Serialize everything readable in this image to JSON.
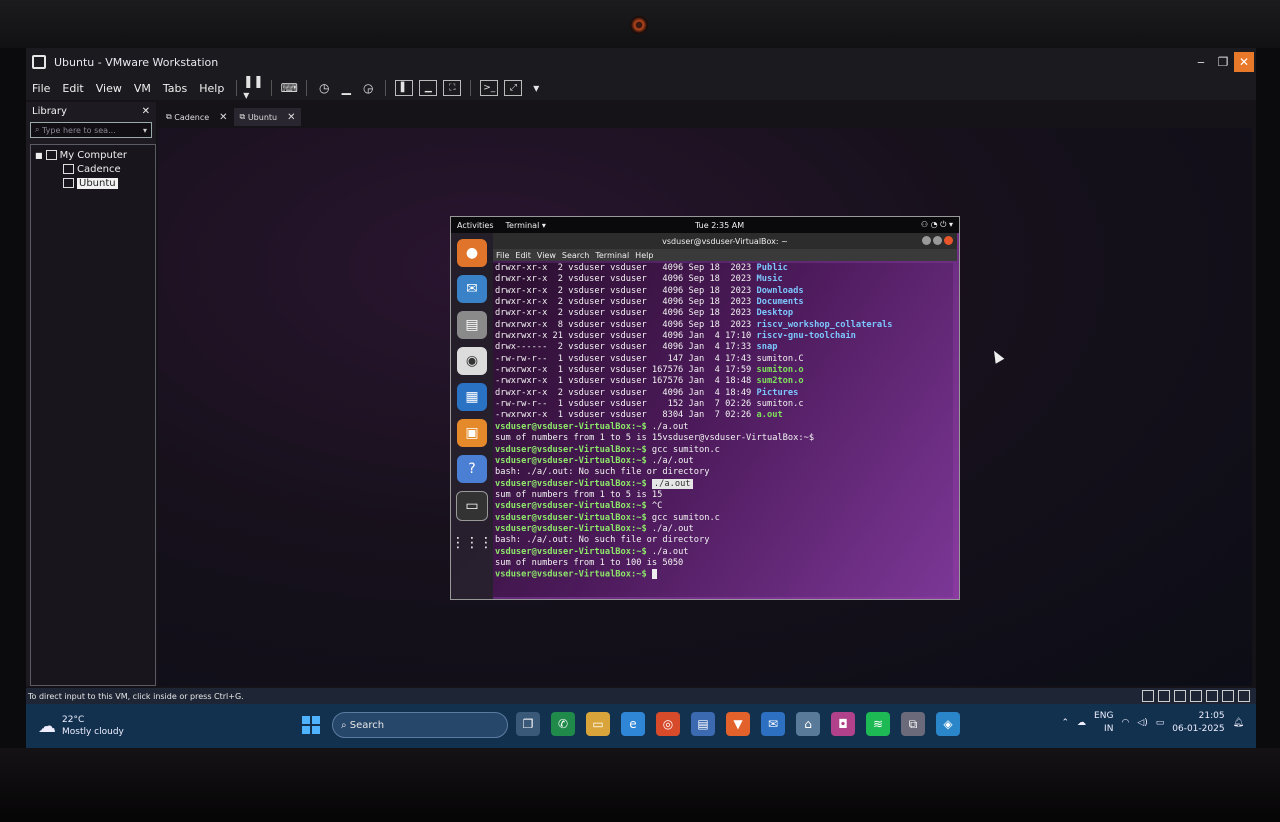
{
  "window": {
    "title": "Ubuntu - VMware Workstation"
  },
  "menu": [
    "File",
    "Edit",
    "View",
    "VM",
    "Tabs",
    "Help"
  ],
  "library": {
    "title": "Library",
    "search_placeholder": "Type here to sea...",
    "root": "My Computer",
    "vms": [
      "Cadence",
      "Ubuntu"
    ],
    "selected": "Ubuntu"
  },
  "tabs": [
    {
      "label": "Cadence"
    },
    {
      "label": "Ubuntu"
    }
  ],
  "guest": {
    "topbar": {
      "activities": "Activities",
      "app": "Terminal ▾",
      "clock": "Tue 2:35 AM"
    },
    "terminal": {
      "title": "vsduser@vsduser-VirtualBox: ~",
      "menu": [
        "File",
        "Edit",
        "View",
        "Search",
        "Terminal",
        "Help"
      ],
      "listing": [
        {
          "perm": "drwxr-xr-x",
          "links": "2",
          "user": "vsduser",
          "group": "vsduser",
          "size": "4096",
          "month": "Sep",
          "day": "18",
          "time": "2023",
          "name": "Public",
          "color": "blue"
        },
        {
          "perm": "drwxr-xr-x",
          "links": "2",
          "user": "vsduser",
          "group": "vsduser",
          "size": "4096",
          "month": "Sep",
          "day": "18",
          "time": "2023",
          "name": "Music",
          "color": "blue"
        },
        {
          "perm": "drwxr-xr-x",
          "links": "2",
          "user": "vsduser",
          "group": "vsduser",
          "size": "4096",
          "month": "Sep",
          "day": "18",
          "time": "2023",
          "name": "Downloads",
          "color": "blue"
        },
        {
          "perm": "drwxr-xr-x",
          "links": "2",
          "user": "vsduser",
          "group": "vsduser",
          "size": "4096",
          "month": "Sep",
          "day": "18",
          "time": "2023",
          "name": "Documents",
          "color": "blue"
        },
        {
          "perm": "drwxr-xr-x",
          "links": "2",
          "user": "vsduser",
          "group": "vsduser",
          "size": "4096",
          "month": "Sep",
          "day": "18",
          "time": "2023",
          "name": "Desktop",
          "color": "blue"
        },
        {
          "perm": "drwxrwxr-x",
          "links": "8",
          "user": "vsduser",
          "group": "vsduser",
          "size": "4096",
          "month": "Sep",
          "day": "18",
          "time": "2023",
          "name": "riscv_workshop_collaterals",
          "color": "blue"
        },
        {
          "perm": "drwxrwxr-x",
          "links": "21",
          "user": "vsduser",
          "group": "vsduser",
          "size": "4096",
          "month": "Jan",
          "day": "4",
          "time": "17:10",
          "name": "riscv-gnu-toolchain",
          "color": "blue"
        },
        {
          "perm": "drwx------",
          "links": "2",
          "user": "vsduser",
          "group": "vsduser",
          "size": "4096",
          "month": "Jan",
          "day": "4",
          "time": "17:33",
          "name": "snap",
          "color": "blue"
        },
        {
          "perm": "-rw-rw-r--",
          "links": "1",
          "user": "vsduser",
          "group": "vsduser",
          "size": "147",
          "month": "Jan",
          "day": "4",
          "time": "17:43",
          "name": "sumiton.C",
          "color": "plain"
        },
        {
          "perm": "-rwxrwxr-x",
          "links": "1",
          "user": "vsduser",
          "group": "vsduser",
          "size": "167576",
          "month": "Jan",
          "day": "4",
          "time": "17:59",
          "name": "sumiton.o",
          "color": "green"
        },
        {
          "perm": "-rwxrwxr-x",
          "links": "1",
          "user": "vsduser",
          "group": "vsduser",
          "size": "167576",
          "month": "Jan",
          "day": "4",
          "time": "18:48",
          "name": "sum2ton.o",
          "color": "green"
        },
        {
          "perm": "drwxr-xr-x",
          "links": "2",
          "user": "vsduser",
          "group": "vsduser",
          "size": "4096",
          "month": "Jan",
          "day": "4",
          "time": "18:49",
          "name": "Pictures",
          "color": "blue"
        },
        {
          "perm": "-rw-rw-r--",
          "links": "1",
          "user": "vsduser",
          "group": "vsduser",
          "size": "152",
          "month": "Jan",
          "day": "7",
          "time": "02:26",
          "name": "sumiton.c",
          "color": "plain"
        },
        {
          "perm": "-rwxrwxr-x",
          "links": "1",
          "user": "vsduser",
          "group": "vsduser",
          "size": "8304",
          "month": "Jan",
          "day": "7",
          "time": "02:26",
          "name": "a.out",
          "color": "green"
        }
      ],
      "prompt": "vsduser@vsduser-VirtualBox:~$",
      "session": [
        {
          "prompt": true,
          "text": " ./a.out"
        },
        {
          "prompt": false,
          "text": "sum of numbers from 1 to 5 is 15vsduser@vsduser-VirtualBox:~$"
        },
        {
          "prompt": true,
          "text": " gcc sumiton.c"
        },
        {
          "prompt": true,
          "text": " ./a/.out"
        },
        {
          "prompt": false,
          "text": "bash: ./a/.out: No such file or directory"
        },
        {
          "prompt": true,
          "text": " ./a.out",
          "highlight": true
        },
        {
          "prompt": false,
          "text": "sum of numbers from 1 to 5 is 15"
        },
        {
          "prompt": true,
          "text": " ^C"
        },
        {
          "prompt": true,
          "text": " gcc sumiton.c"
        },
        {
          "prompt": true,
          "text": " ./a/.out"
        },
        {
          "prompt": false,
          "text": "bash: ./a/.out: No such file or directory"
        },
        {
          "prompt": true,
          "text": " ./a.out"
        },
        {
          "prompt": false,
          "text": "sum of numbers from 1 to 100 is 5050"
        },
        {
          "prompt": true,
          "text": " ",
          "cursor": true
        }
      ]
    }
  },
  "status_bar": {
    "hint": "To direct input to this VM, click inside or press Ctrl+G."
  },
  "taskbar": {
    "weather_temp": "22°C",
    "weather_desc": "Mostly cloudy",
    "search_label": "Search",
    "lang_1": "ENG",
    "lang_2": "IN",
    "time": "21:05",
    "date": "06-01-2025"
  }
}
